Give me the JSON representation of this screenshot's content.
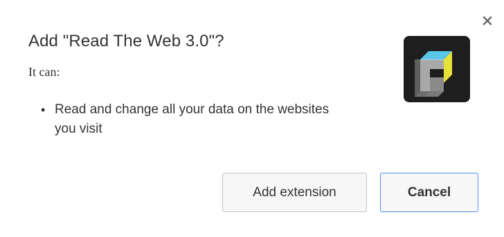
{
  "dialog": {
    "title": "Add \"Read The Web 3.0\"?",
    "subtitle": "It can:",
    "permissions": [
      "Read and change all your data on the websites you visit"
    ],
    "bullet": "•"
  },
  "buttons": {
    "add_label": "Add extension",
    "cancel_label": "Cancel"
  },
  "icons": {
    "close": "close-icon",
    "app": "read-the-web-app-icon"
  },
  "colors": {
    "focus_border": "#4d90fe",
    "icon_cyan": "#58c7e8",
    "icon_yellow": "#e6e23a",
    "icon_bg": "#1e1e1e"
  }
}
